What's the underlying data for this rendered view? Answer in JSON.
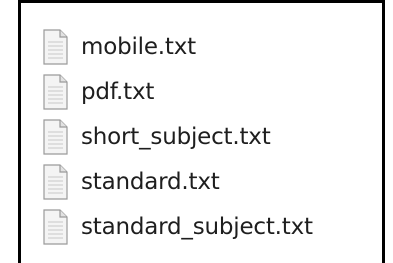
{
  "files": [
    {
      "name": "mobile.txt",
      "icon": "text-file-icon"
    },
    {
      "name": "pdf.txt",
      "icon": "text-file-icon"
    },
    {
      "name": "short_subject.txt",
      "icon": "text-file-icon"
    },
    {
      "name": "standard.txt",
      "icon": "text-file-icon"
    },
    {
      "name": "standard_subject.txt",
      "icon": "text-file-icon"
    }
  ],
  "colors": {
    "border": "#000000",
    "text": "#1e1e1e",
    "icon_fill": "#f4f4f4",
    "icon_stroke": "#9a9a9a",
    "icon_lines": "#c8c8c8"
  }
}
